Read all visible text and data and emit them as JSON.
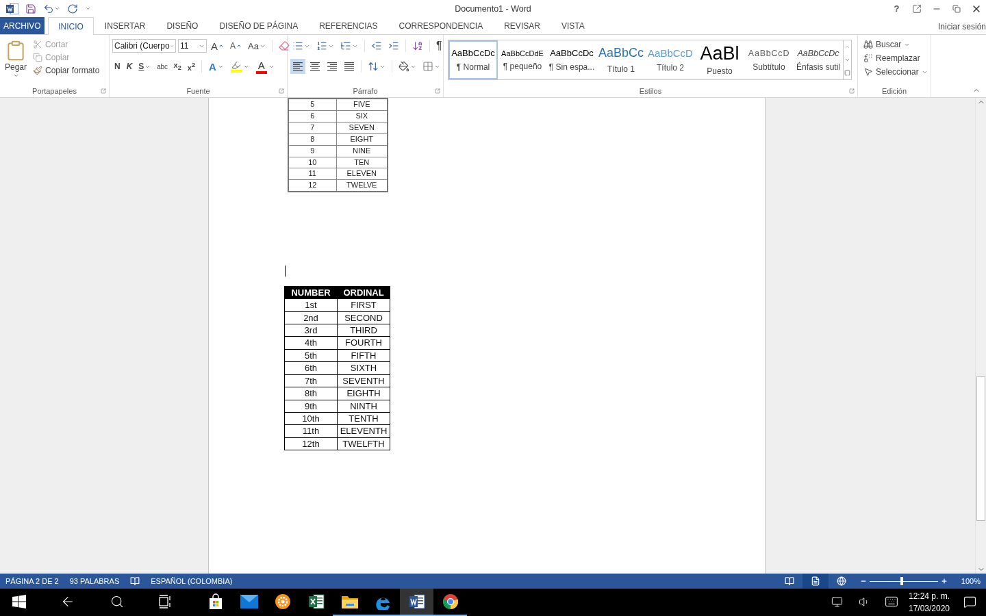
{
  "title_bar": {
    "title": "Documento1 - Word",
    "help": "?"
  },
  "ribbon_tabs": [
    {
      "label": "ARCHIVO",
      "kind": "file",
      "selected": false
    },
    {
      "label": "INICIO",
      "kind": "tab",
      "selected": true
    },
    {
      "label": "INSERTAR",
      "kind": "tab",
      "selected": false
    },
    {
      "label": "DISEÑO",
      "kind": "tab",
      "selected": false
    },
    {
      "label": "DISEÑO DE PÁGINA",
      "kind": "tab",
      "selected": false
    },
    {
      "label": "REFERENCIAS",
      "kind": "tab",
      "selected": false
    },
    {
      "label": "CORRESPONDENCIA",
      "kind": "tab",
      "selected": false
    },
    {
      "label": "REVISAR",
      "kind": "tab",
      "selected": false
    },
    {
      "label": "VISTA",
      "kind": "tab",
      "selected": false
    }
  ],
  "sign_in": "Iniciar sesión",
  "clipboard": {
    "paste": "Pegar",
    "group_label": "Portapapeles",
    "actions": [
      {
        "kind": "cut",
        "label": "Cortar",
        "disabled": true
      },
      {
        "kind": "copy",
        "label": "Copiar",
        "disabled": true
      },
      {
        "kind": "format_painter",
        "label": "Copiar formato",
        "disabled": false
      }
    ]
  },
  "font": {
    "font_name": "Calibri (Cuerpo",
    "font_size": "11",
    "group_label": "Fuente",
    "letter_tools": [
      {
        "kind": "grow",
        "label": "A"
      },
      {
        "kind": "shrink",
        "label": "A"
      },
      {
        "kind": "change_case",
        "label": "Aa"
      }
    ],
    "format_buttons": [
      {
        "kind": "bold",
        "label": "N"
      },
      {
        "kind": "italic",
        "label": "K"
      },
      {
        "kind": "underline",
        "label": "S"
      },
      {
        "kind": "strike",
        "label": "abc"
      },
      {
        "kind": "subscript",
        "label": "x$_{2}$"
      },
      {
        "kind": "superscript",
        "label": "x$^{2}$"
      }
    ],
    "color_tools": [
      {
        "kind": "effects",
        "label": "A"
      },
      {
        "kind": "highlight",
        "color": "#ffff00"
      },
      {
        "kind": "font_color",
        "label": "A",
        "color": "#ff0000"
      }
    ]
  },
  "paragraph": {
    "group_label": "Párrafo",
    "show_marks": "¶",
    "alignments": [
      {
        "kind": "left",
        "selected": true
      },
      {
        "kind": "center",
        "selected": false
      },
      {
        "kind": "right",
        "selected": false
      },
      {
        "kind": "justify",
        "selected": false
      }
    ]
  },
  "styles": {
    "group_label": "Estilos",
    "items": [
      {
        "kind": "normal",
        "preview": "AaBbCcDc",
        "name": "¶ Normal",
        "selected": true
      },
      {
        "kind": "small",
        "preview": "AaBbCcDdE",
        "name": "¶ pequeño",
        "selected": false
      },
      {
        "kind": "nospace",
        "preview": "AaBbCcDc",
        "name": "¶ Sin espa...",
        "selected": false
      },
      {
        "kind": "heading1",
        "preview": "AaBbCc",
        "name": "Título 1",
        "selected": false
      },
      {
        "kind": "heading2",
        "preview": "AaBbCcD",
        "name": "Título 2",
        "selected": false
      },
      {
        "kind": "title",
        "preview": "AaBl",
        "name": "Puesto",
        "selected": false
      },
      {
        "kind": "subtitle",
        "preview": "AaBbCcD",
        "name": "Subtítulo",
        "selected": false
      },
      {
        "kind": "emphasis",
        "preview": "AaBbCcDc",
        "name": "Énfasis sutil",
        "selected": false
      }
    ]
  },
  "editing": {
    "group_label": "Edición",
    "actions": [
      {
        "kind": "find",
        "label": "Buscar"
      },
      {
        "kind": "replace",
        "label": "Reemplazar"
      },
      {
        "kind": "select",
        "label": "Seleccionar"
      }
    ]
  },
  "document": {
    "table_top": {
      "rows": [
        [
          "5",
          "FIVE"
        ],
        [
          "6",
          "SIX"
        ],
        [
          "7",
          "SEVEN"
        ],
        [
          "8",
          "EIGHT"
        ],
        [
          "9",
          "NINE"
        ],
        [
          "10",
          "TEN"
        ],
        [
          "11",
          "ELEVEN"
        ],
        [
          "12",
          "TWELVE"
        ]
      ]
    },
    "table_ordinals": {
      "columns": [
        "NUMBER",
        "ORDINAL"
      ],
      "rows": [
        [
          "1st",
          "FIRST"
        ],
        [
          "2nd",
          "SECOND"
        ],
        [
          "3rd",
          "THIRD"
        ],
        [
          "4th",
          "FOURTH"
        ],
        [
          "5th",
          "FIFTH"
        ],
        [
          "6th",
          "SIXTH"
        ],
        [
          "7th",
          "SEVENTH"
        ],
        [
          "8th",
          "EIGHTH"
        ],
        [
          "9th",
          "NINTH"
        ],
        [
          "10th",
          "TENTH"
        ],
        [
          "11th",
          "ELEVENTH"
        ],
        [
          "12th",
          "TWELFTH"
        ]
      ]
    }
  },
  "status_bar": {
    "page": "PÁGINA 2 DE 2",
    "words": "93 PALABRAS",
    "language": "ESPAÑOL (COLOMBIA)",
    "views": [
      {
        "kind": "read",
        "selected": false
      },
      {
        "kind": "print",
        "selected": true
      },
      {
        "kind": "web",
        "selected": false
      }
    ],
    "zoom": {
      "level": 0.47,
      "reading": "100%"
    }
  },
  "taskbar": {
    "apps": [
      {
        "kind": "store",
        "running": false,
        "selected": false
      },
      {
        "kind": "mail",
        "running": false,
        "selected": false
      },
      {
        "kind": "orange",
        "running": false,
        "selected": false
      },
      {
        "kind": "excel",
        "running": false,
        "selected": false
      },
      {
        "kind": "explorer",
        "running": true,
        "selected": false
      },
      {
        "kind": "edge",
        "running": true,
        "selected": false
      },
      {
        "kind": "word",
        "running": true,
        "selected": true
      },
      {
        "kind": "chrome",
        "running": true,
        "selected": false
      }
    ],
    "time": "12:24 p. m.",
    "date": "17/03/2020"
  }
}
